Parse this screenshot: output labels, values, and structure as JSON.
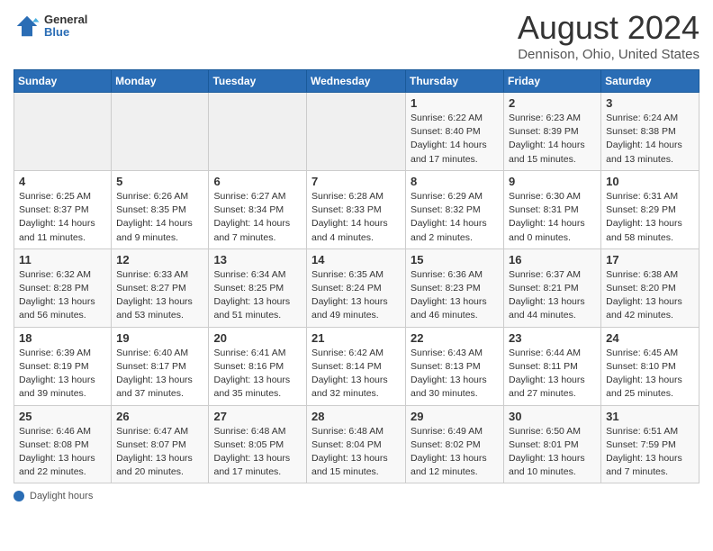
{
  "header": {
    "logo": {
      "general": "General",
      "blue": "Blue"
    },
    "title": "August 2024",
    "location": "Dennison, Ohio, United States"
  },
  "calendar": {
    "days_of_week": [
      "Sunday",
      "Monday",
      "Tuesday",
      "Wednesday",
      "Thursday",
      "Friday",
      "Saturday"
    ],
    "weeks": [
      [
        {
          "day": "",
          "info": ""
        },
        {
          "day": "",
          "info": ""
        },
        {
          "day": "",
          "info": ""
        },
        {
          "day": "",
          "info": ""
        },
        {
          "day": "1",
          "info": "Sunrise: 6:22 AM\nSunset: 8:40 PM\nDaylight: 14 hours and 17 minutes."
        },
        {
          "day": "2",
          "info": "Sunrise: 6:23 AM\nSunset: 8:39 PM\nDaylight: 14 hours and 15 minutes."
        },
        {
          "day": "3",
          "info": "Sunrise: 6:24 AM\nSunset: 8:38 PM\nDaylight: 14 hours and 13 minutes."
        }
      ],
      [
        {
          "day": "4",
          "info": "Sunrise: 6:25 AM\nSunset: 8:37 PM\nDaylight: 14 hours and 11 minutes."
        },
        {
          "day": "5",
          "info": "Sunrise: 6:26 AM\nSunset: 8:35 PM\nDaylight: 14 hours and 9 minutes."
        },
        {
          "day": "6",
          "info": "Sunrise: 6:27 AM\nSunset: 8:34 PM\nDaylight: 14 hours and 7 minutes."
        },
        {
          "day": "7",
          "info": "Sunrise: 6:28 AM\nSunset: 8:33 PM\nDaylight: 14 hours and 4 minutes."
        },
        {
          "day": "8",
          "info": "Sunrise: 6:29 AM\nSunset: 8:32 PM\nDaylight: 14 hours and 2 minutes."
        },
        {
          "day": "9",
          "info": "Sunrise: 6:30 AM\nSunset: 8:31 PM\nDaylight: 14 hours and 0 minutes."
        },
        {
          "day": "10",
          "info": "Sunrise: 6:31 AM\nSunset: 8:29 PM\nDaylight: 13 hours and 58 minutes."
        }
      ],
      [
        {
          "day": "11",
          "info": "Sunrise: 6:32 AM\nSunset: 8:28 PM\nDaylight: 13 hours and 56 minutes."
        },
        {
          "day": "12",
          "info": "Sunrise: 6:33 AM\nSunset: 8:27 PM\nDaylight: 13 hours and 53 minutes."
        },
        {
          "day": "13",
          "info": "Sunrise: 6:34 AM\nSunset: 8:25 PM\nDaylight: 13 hours and 51 minutes."
        },
        {
          "day": "14",
          "info": "Sunrise: 6:35 AM\nSunset: 8:24 PM\nDaylight: 13 hours and 49 minutes."
        },
        {
          "day": "15",
          "info": "Sunrise: 6:36 AM\nSunset: 8:23 PM\nDaylight: 13 hours and 46 minutes."
        },
        {
          "day": "16",
          "info": "Sunrise: 6:37 AM\nSunset: 8:21 PM\nDaylight: 13 hours and 44 minutes."
        },
        {
          "day": "17",
          "info": "Sunrise: 6:38 AM\nSunset: 8:20 PM\nDaylight: 13 hours and 42 minutes."
        }
      ],
      [
        {
          "day": "18",
          "info": "Sunrise: 6:39 AM\nSunset: 8:19 PM\nDaylight: 13 hours and 39 minutes."
        },
        {
          "day": "19",
          "info": "Sunrise: 6:40 AM\nSunset: 8:17 PM\nDaylight: 13 hours and 37 minutes."
        },
        {
          "day": "20",
          "info": "Sunrise: 6:41 AM\nSunset: 8:16 PM\nDaylight: 13 hours and 35 minutes."
        },
        {
          "day": "21",
          "info": "Sunrise: 6:42 AM\nSunset: 8:14 PM\nDaylight: 13 hours and 32 minutes."
        },
        {
          "day": "22",
          "info": "Sunrise: 6:43 AM\nSunset: 8:13 PM\nDaylight: 13 hours and 30 minutes."
        },
        {
          "day": "23",
          "info": "Sunrise: 6:44 AM\nSunset: 8:11 PM\nDaylight: 13 hours and 27 minutes."
        },
        {
          "day": "24",
          "info": "Sunrise: 6:45 AM\nSunset: 8:10 PM\nDaylight: 13 hours and 25 minutes."
        }
      ],
      [
        {
          "day": "25",
          "info": "Sunrise: 6:46 AM\nSunset: 8:08 PM\nDaylight: 13 hours and 22 minutes."
        },
        {
          "day": "26",
          "info": "Sunrise: 6:47 AM\nSunset: 8:07 PM\nDaylight: 13 hours and 20 minutes."
        },
        {
          "day": "27",
          "info": "Sunrise: 6:48 AM\nSunset: 8:05 PM\nDaylight: 13 hours and 17 minutes."
        },
        {
          "day": "28",
          "info": "Sunrise: 6:48 AM\nSunset: 8:04 PM\nDaylight: 13 hours and 15 minutes."
        },
        {
          "day": "29",
          "info": "Sunrise: 6:49 AM\nSunset: 8:02 PM\nDaylight: 13 hours and 12 minutes."
        },
        {
          "day": "30",
          "info": "Sunrise: 6:50 AM\nSunset: 8:01 PM\nDaylight: 13 hours and 10 minutes."
        },
        {
          "day": "31",
          "info": "Sunrise: 6:51 AM\nSunset: 7:59 PM\nDaylight: 13 hours and 7 minutes."
        }
      ]
    ]
  },
  "footer": {
    "label": "Daylight hours"
  }
}
